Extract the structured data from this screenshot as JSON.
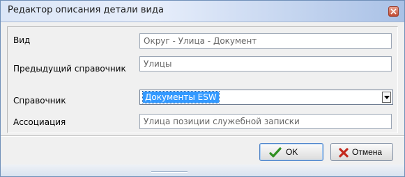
{
  "window": {
    "title": "Редактор описания детали вида"
  },
  "form": {
    "vid_label": "Вид",
    "vid_value": "Округ - Улица - Документ",
    "prev_ref_label": "Предыдущий справочник",
    "prev_ref_value": "Улицы",
    "ref_label": "Справочник",
    "ref_value": "Документы ESW",
    "assoc_label": "Ассоциация",
    "assoc_value": "Улица позиции служебной записки"
  },
  "buttons": {
    "ok_label": "OK",
    "cancel_label": "Отмена"
  },
  "icons": {
    "close": "close-icon",
    "dropdown": "chevron-down-icon",
    "ok": "checkmark-icon",
    "cancel": "x-mark-icon"
  },
  "colors": {
    "selection": "#3399ff",
    "ok_icon": "#2f8f22",
    "cancel_icon": "#c3291d"
  }
}
